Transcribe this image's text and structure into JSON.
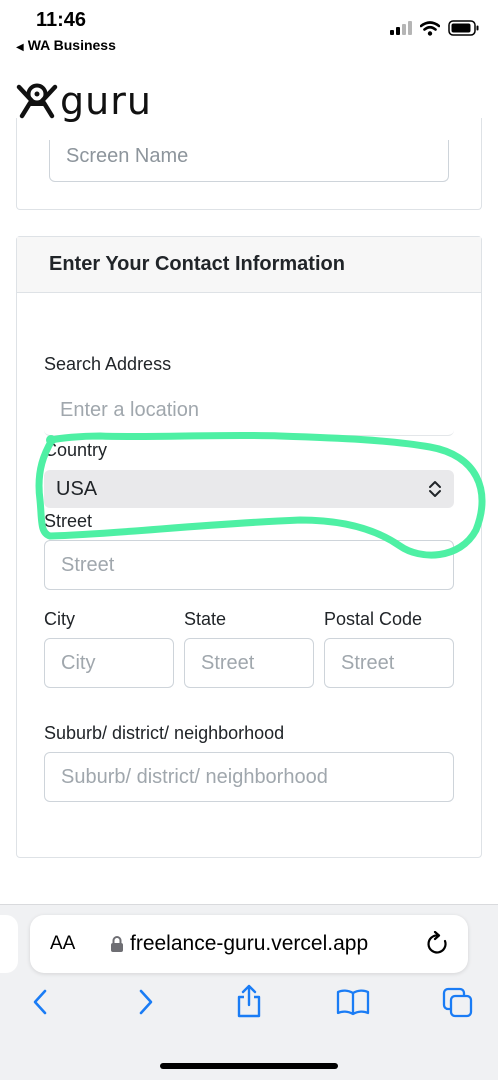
{
  "status_bar": {
    "time": "11:46",
    "back_app": "WA Business"
  },
  "header": {
    "logo_text": "guru"
  },
  "profile_card": {
    "screen_name_placeholder": "Screen Name"
  },
  "contact_card": {
    "title": "Enter Your Contact Information",
    "search_address_label": "Search Address",
    "search_address_placeholder": "Enter a location",
    "country_label": "Country",
    "country_value": "USA",
    "street_label": "Street",
    "street_placeholder": "Street",
    "city_label": "City",
    "city_placeholder": "City",
    "state_label": "State",
    "state_placeholder": "Street",
    "postal_label": "Postal Code",
    "postal_placeholder": "Street",
    "suburb_label": "Suburb/ district/ neighborhood",
    "suburb_placeholder": "Suburb/ district/ neighborhood"
  },
  "browser": {
    "text_size_label": "AA",
    "url": "freelance-guru.vercel.app"
  },
  "colors": {
    "highlight": "#4ef0a4",
    "ios_blue": "#1a7cf5"
  }
}
